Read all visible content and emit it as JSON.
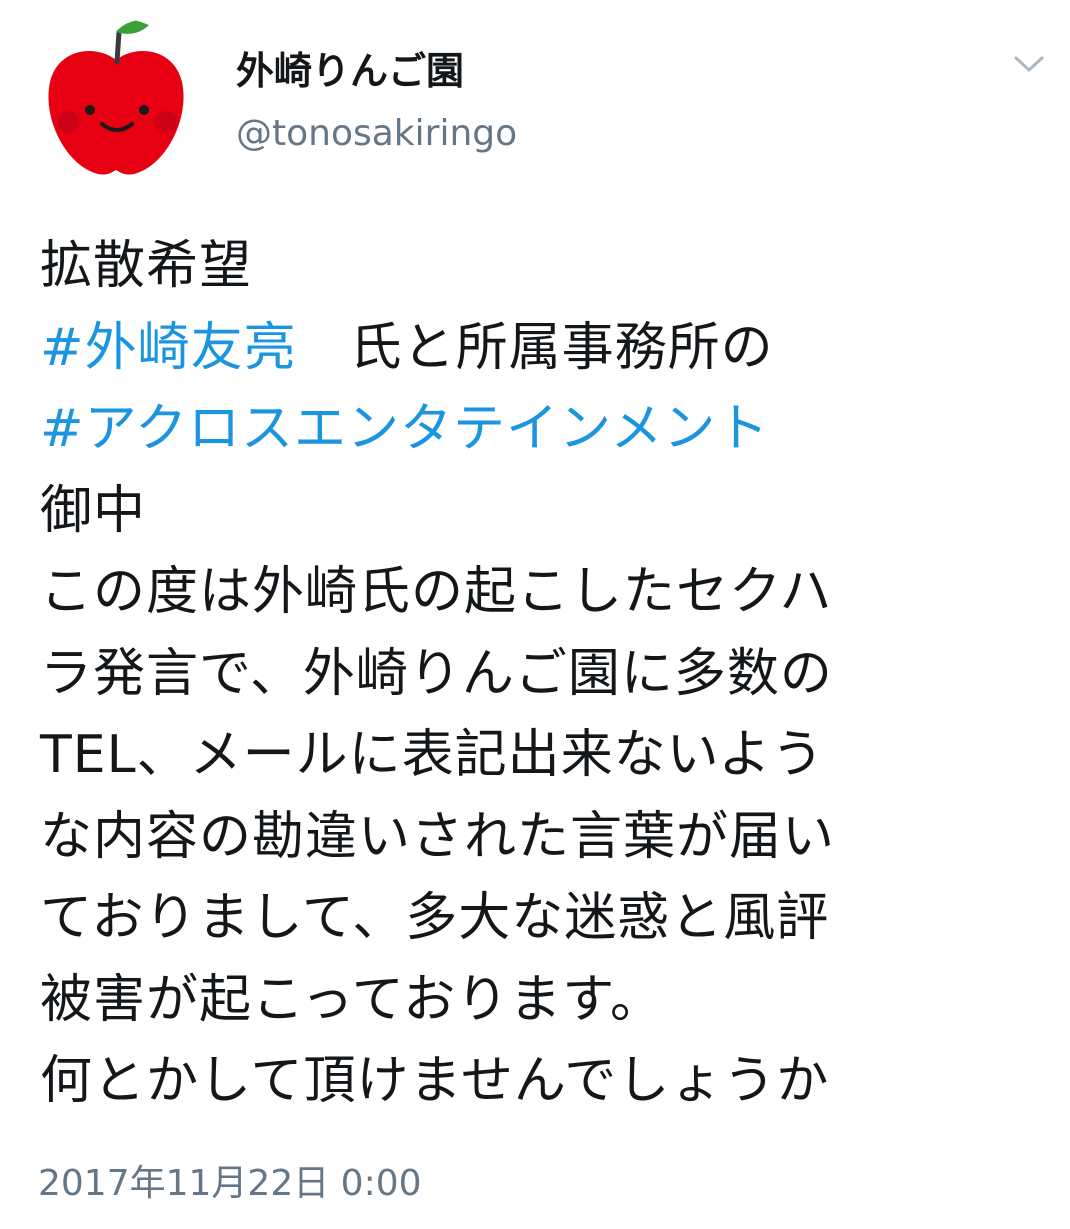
{
  "account": {
    "display_name": "外崎りんご園",
    "handle": "@tonosakiringo",
    "avatar_icon": "apple-character-icon",
    "menu_icon": "chevron-down-icon"
  },
  "tweet": {
    "lines": {
      "l1": "拡散希望",
      "l2_hashtag": "#外崎友亮",
      "l2_text": "　氏と所属事務所の",
      "l3_hashtag": "#アクロスエンタテインメント",
      "l4": "御中",
      "l5": "この度は外崎氏の起こしたセクハ",
      "l6": "ラ発言で、外崎りんご園に多数の",
      "l7": "TEL、メールに表記出来ないよう",
      "l8": "な内容の勘違いされた言葉が届い",
      "l9": "ておりまして、多大な迷惑と風評",
      "l10": "被害が起こっております。",
      "l11": "何とかして頂けませんでしょうか"
    },
    "timestamp": "2017年11月22日 0:00"
  },
  "colors": {
    "hashtag": "#1b95e0",
    "secondary_text": "#657786",
    "primary_text": "#14171a",
    "apple_red": "#e60012"
  }
}
